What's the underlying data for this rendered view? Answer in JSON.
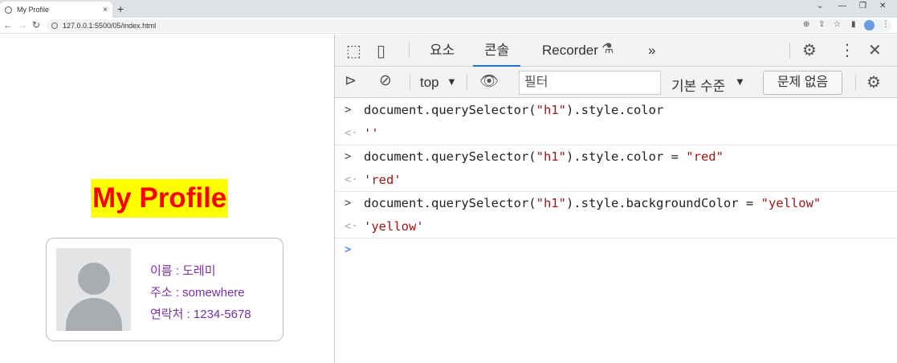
{
  "browser": {
    "tab_title": "My Profile",
    "tab_close": "×",
    "new_tab": "+",
    "url": "127.0.0.1:5500/05/index.html",
    "window_controls": [
      "⌄",
      "—",
      "❐",
      "✕"
    ]
  },
  "page": {
    "heading": "My Profile",
    "card": {
      "name_line": "이름 : 도레미",
      "address_line": "주소 : somewhere",
      "phone_line": "연락처 : 1234-5678"
    }
  },
  "devtools": {
    "tabs": [
      "요소",
      "콘솔",
      "Recorder",
      "»"
    ],
    "active_tab": "콘솔",
    "context": "top",
    "filter_placeholder": "필터",
    "log_level": "기본 수준",
    "issues_button": "문제 없음",
    "console": [
      {
        "type": "input",
        "parts": [
          {
            "t": "document.querySelector(",
            "s": false
          },
          {
            "t": "\"h1\"",
            "s": true
          },
          {
            "t": ").style.color",
            "s": false
          }
        ]
      },
      {
        "type": "output",
        "value": "''"
      },
      {
        "type": "input",
        "parts": [
          {
            "t": "document.querySelector(",
            "s": false
          },
          {
            "t": "\"h1\"",
            "s": true
          },
          {
            "t": ").style.color = ",
            "s": false
          },
          {
            "t": "\"red\"",
            "s": true
          }
        ]
      },
      {
        "type": "output",
        "value": "'red'"
      },
      {
        "type": "input",
        "parts": [
          {
            "t": "document.querySelector(",
            "s": false
          },
          {
            "t": "\"h1\"",
            "s": true
          },
          {
            "t": ").style.backgroundColor = ",
            "s": false
          },
          {
            "t": "\"yellow\"",
            "s": true
          }
        ]
      },
      {
        "type": "output",
        "value": "'yellow'"
      }
    ]
  },
  "colors": {
    "heading_text": "#ff0000",
    "heading_bg": "#ffff00",
    "card_text": "#7b2fa8",
    "active_tab_underline": "#1a73e8"
  }
}
